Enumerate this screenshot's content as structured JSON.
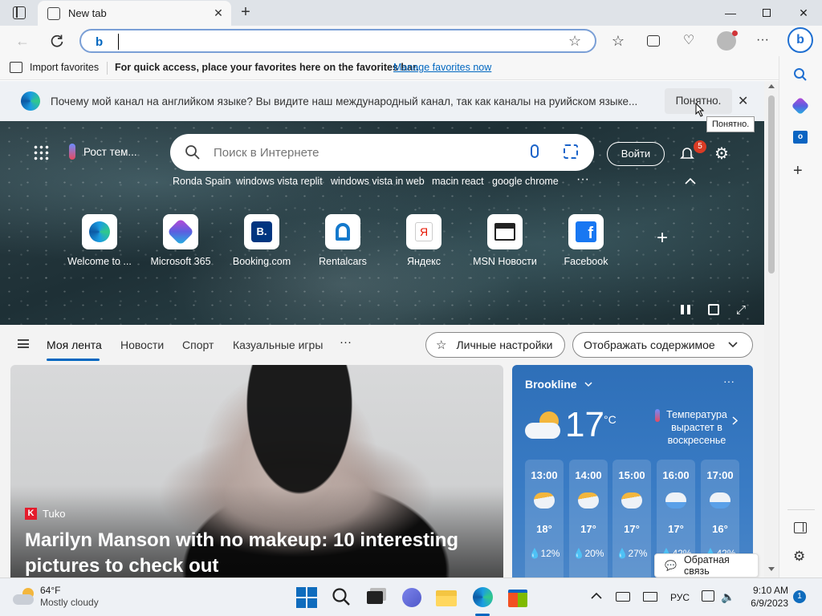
{
  "browser": {
    "tab_title": "New tab",
    "address_value": "",
    "favbar": {
      "import_label": "Import favorites",
      "hint": "For quick access, place your favorites here on the favorites bar.",
      "manage_link": "Manage favorites now"
    }
  },
  "notice": {
    "text": "Почему мой канал на английком языке? Вы видите наш международный канал, так как каналы на руийском языке...",
    "ok_label": "Понятно.",
    "tooltip": "Понятно."
  },
  "hero": {
    "weather_chip": "Рост тем...",
    "search_placeholder": "Поиск в Интернете",
    "signin_label": "Войти",
    "notification_count": "5",
    "suggestions": [
      "Ronda Spain",
      "windows vista replit",
      "windows vista in web",
      "macin react",
      "google chrome"
    ],
    "tiles": [
      {
        "label": "Welcome to ...",
        "icon": "edge-icon"
      },
      {
        "label": "Microsoft 365",
        "icon": "microsoft365-icon"
      },
      {
        "label": "Booking.com",
        "icon": "booking-icon"
      },
      {
        "label": "Rentalcars",
        "icon": "rentalcars-icon"
      },
      {
        "label": "Яндекс",
        "icon": "yandex-icon"
      },
      {
        "label": "MSN Новости",
        "icon": "msn-news-icon"
      },
      {
        "label": "Facebook",
        "icon": "facebook-icon"
      }
    ]
  },
  "feednav": {
    "tabs": [
      "Моя лента",
      "Новости",
      "Спорт",
      "Казуальные игры"
    ],
    "personalize_label": "Личные настройки",
    "display_label": "Отображать содержимое"
  },
  "article": {
    "source": "Tuko",
    "headline": "Marilyn Manson with no makeup: 10 interesting pictures to check out"
  },
  "weather_card": {
    "location": "Brookline",
    "temp": "17",
    "unit": "°C",
    "alert": "Температура вырастет в воскресенье",
    "hours": [
      {
        "time": "13:00",
        "temp": "18°",
        "precip": "12%",
        "icon": "partly-cloudy-icon"
      },
      {
        "time": "14:00",
        "temp": "17°",
        "precip": "20%",
        "icon": "partly-cloudy-icon"
      },
      {
        "time": "15:00",
        "temp": "17°",
        "precip": "27%",
        "icon": "partly-cloudy-icon"
      },
      {
        "time": "16:00",
        "temp": "17°",
        "precip": "42%",
        "icon": "rain-icon"
      },
      {
        "time": "17:00",
        "temp": "16°",
        "precip": "42%",
        "icon": "rain-icon"
      }
    ],
    "feedback_label": "Обратная связь"
  },
  "taskbar": {
    "weather_temp": "64°F",
    "weather_desc": "Mostly cloudy",
    "lang": "РУС",
    "time": "9:10 AM",
    "date": "6/9/2023",
    "notif_count": "1"
  },
  "colors": {
    "accent": "#0067c0",
    "weather_bg": "#2e6fb8",
    "hero_bg": "#23363c"
  }
}
